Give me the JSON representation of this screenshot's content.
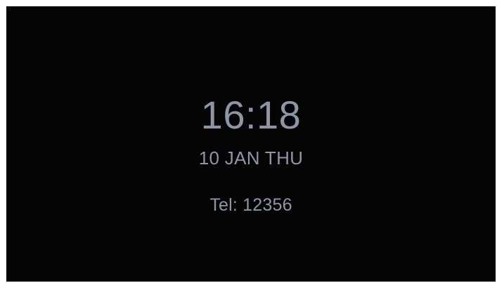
{
  "screen": {
    "time": "16:18",
    "date": "10 JAN THU",
    "phone_line": "Tel: 12356"
  },
  "colors": {
    "background": "#050505",
    "text": "#8e95a5",
    "outer_border": "#ffffff"
  }
}
